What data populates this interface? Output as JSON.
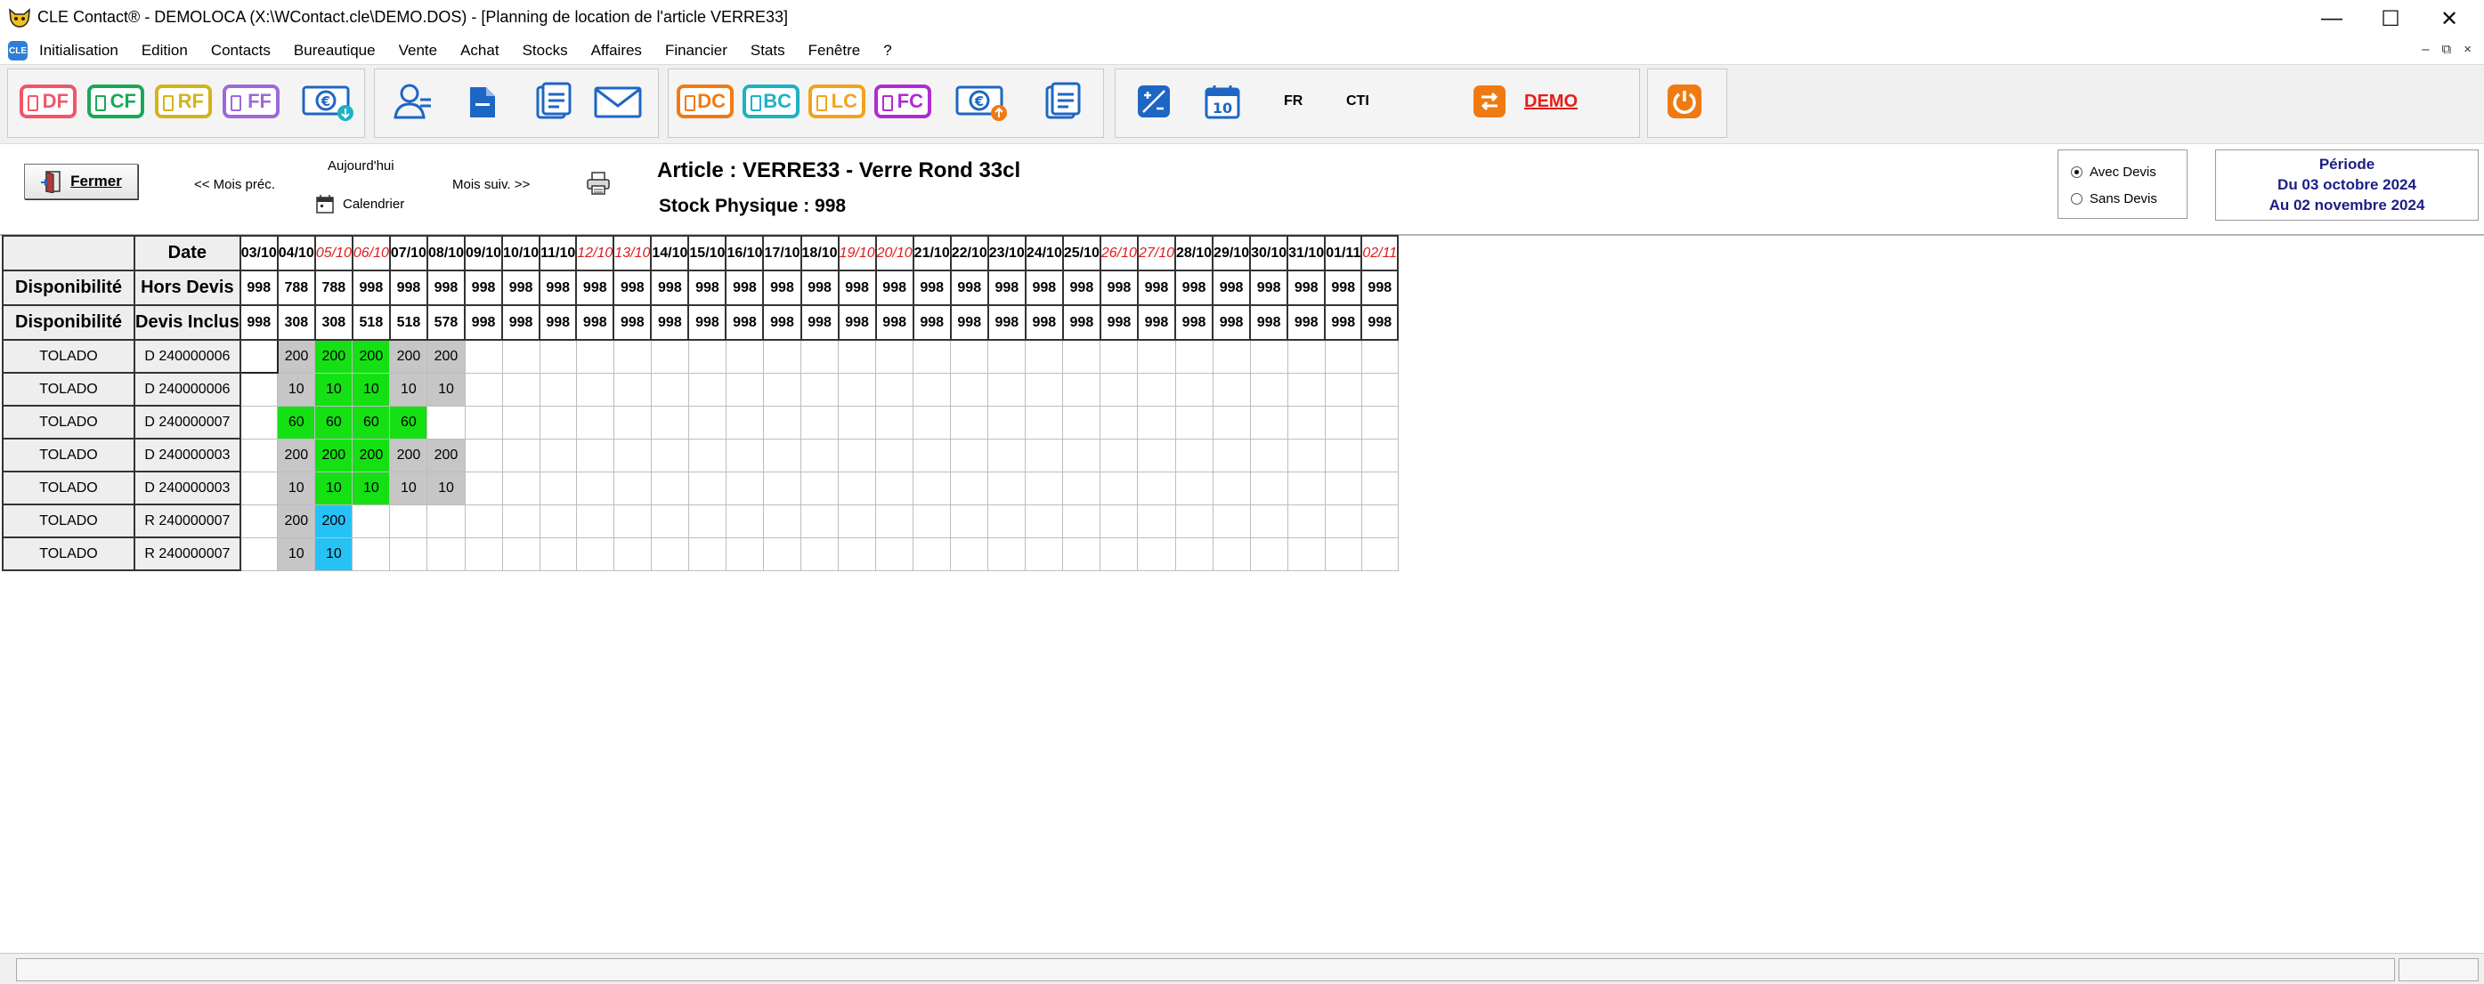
{
  "window": {
    "title": "CLE Contact® - DEMOLOCA (X:\\WContact.cle\\DEMO.DOS) - [Planning de location de l'article VERRE33]",
    "minimize": "—",
    "maximize": "☐",
    "close": "✕"
  },
  "menu": {
    "items": [
      "Initialisation",
      "Edition",
      "Contacts",
      "Bureautique",
      "Vente",
      "Achat",
      "Stocks",
      "Affaires",
      "Financier",
      "Stats",
      "Fenêtre",
      "?"
    ],
    "mdi": [
      "–",
      "⧉",
      "×"
    ]
  },
  "toolbar": {
    "badges": [
      {
        "label": "DF",
        "color": "#f0566a"
      },
      {
        "label": "CF",
        "color": "#19a85a"
      },
      {
        "label": "RF",
        "color": "#d4b21a"
      },
      {
        "label": "FF",
        "color": "#9b6ad8"
      },
      {
        "label": "DC",
        "color": "#f07a12"
      },
      {
        "label": "BC",
        "color": "#1fb1c4"
      },
      {
        "label": "LC",
        "color": "#f2a21c"
      },
      {
        "label": "FC",
        "color": "#b12bd1"
      }
    ],
    "calendar_day": "10",
    "lang": "FR",
    "cti": "CTI",
    "demo": "DEMO",
    "accent": "#1e66c4",
    "demo_color": "#e0201b",
    "orange": "#f07a12"
  },
  "controls": {
    "close_label": "Fermer",
    "prev_month": "<< Mois préc.",
    "today": "Aujourd'hui",
    "calendar": "Calendrier",
    "next_month": "Mois suiv. >>",
    "article": "Article : VERRE33 - Verre Rond 33cl",
    "stock": "Stock Physique : 998",
    "radio_with": "Avec Devis",
    "radio_without": "Sans Devis",
    "radio_selected": "Avec Devis",
    "period_title": "Période",
    "period_from": "Du 03 octobre 2024",
    "period_to": "Au 02 novembre 2024"
  },
  "grid": {
    "col1_header": "",
    "col2_header": "Date",
    "dates": [
      "03/10",
      "04/10",
      "05/10",
      "06/10",
      "07/10",
      "08/10",
      "09/10",
      "10/10",
      "11/10",
      "12/10",
      "13/10",
      "14/10",
      "15/10",
      "16/10",
      "17/10",
      "18/10",
      "19/10",
      "20/10",
      "21/10",
      "22/10",
      "23/10",
      "24/10",
      "25/10",
      "26/10",
      "27/10",
      "28/10",
      "29/10",
      "30/10",
      "31/10",
      "01/11",
      "02/11"
    ],
    "weekend_dates": [
      "05/10",
      "06/10",
      "12/10",
      "13/10",
      "19/10",
      "20/10",
      "26/10",
      "27/10",
      "02/11"
    ],
    "availability": [
      {
        "label": "Disponibilité",
        "type": "Hors Devis",
        "values": [
          "998",
          "788",
          "788",
          "998",
          "998",
          "998",
          "998",
          "998",
          "998",
          "998",
          "998",
          "998",
          "998",
          "998",
          "998",
          "998",
          "998",
          "998",
          "998",
          "998",
          "998",
          "998",
          "998",
          "998",
          "998",
          "998",
          "998",
          "998",
          "998",
          "998",
          "998"
        ]
      },
      {
        "label": "Disponibilité",
        "type": "Devis Inclus",
        "values": [
          "998",
          "308",
          "308",
          "518",
          "518",
          "578",
          "998",
          "998",
          "998",
          "998",
          "998",
          "998",
          "998",
          "998",
          "998",
          "998",
          "998",
          "998",
          "998",
          "998",
          "998",
          "998",
          "998",
          "998",
          "998",
          "998",
          "998",
          "998",
          "998",
          "998",
          "998"
        ]
      }
    ],
    "rows": [
      {
        "client": "TOLADO",
        "doc": "D 240000006",
        "cells": [
          {
            "v": "",
            "c": "sel"
          },
          {
            "v": "200",
            "c": "grey"
          },
          {
            "v": "200",
            "c": "green"
          },
          {
            "v": "200",
            "c": "green"
          },
          {
            "v": "200",
            "c": "grey"
          },
          {
            "v": "200",
            "c": "grey"
          }
        ]
      },
      {
        "client": "TOLADO",
        "doc": "D 240000006",
        "cells": [
          {
            "v": "",
            "c": "empty"
          },
          {
            "v": "10",
            "c": "grey"
          },
          {
            "v": "10",
            "c": "green"
          },
          {
            "v": "10",
            "c": "green"
          },
          {
            "v": "10",
            "c": "grey"
          },
          {
            "v": "10",
            "c": "grey"
          }
        ]
      },
      {
        "client": "TOLADO",
        "doc": "D 240000007",
        "cells": [
          {
            "v": "",
            "c": "empty"
          },
          {
            "v": "60",
            "c": "green"
          },
          {
            "v": "60",
            "c": "green"
          },
          {
            "v": "60",
            "c": "green"
          },
          {
            "v": "60",
            "c": "green"
          }
        ]
      },
      {
        "client": "TOLADO",
        "doc": "D 240000003",
        "cells": [
          {
            "v": "",
            "c": "empty"
          },
          {
            "v": "200",
            "c": "grey"
          },
          {
            "v": "200",
            "c": "green"
          },
          {
            "v": "200",
            "c": "green"
          },
          {
            "v": "200",
            "c": "grey"
          },
          {
            "v": "200",
            "c": "grey"
          }
        ]
      },
      {
        "client": "TOLADO",
        "doc": "D 240000003",
        "cells": [
          {
            "v": "",
            "c": "empty"
          },
          {
            "v": "10",
            "c": "grey"
          },
          {
            "v": "10",
            "c": "green"
          },
          {
            "v": "10",
            "c": "green"
          },
          {
            "v": "10",
            "c": "grey"
          },
          {
            "v": "10",
            "c": "grey"
          }
        ]
      },
      {
        "client": "TOLADO",
        "doc": "R 240000007",
        "cells": [
          {
            "v": "",
            "c": "empty"
          },
          {
            "v": "200",
            "c": "grey"
          },
          {
            "v": "200",
            "c": "blue"
          }
        ]
      },
      {
        "client": "TOLADO",
        "doc": "R 240000007",
        "cells": [
          {
            "v": "",
            "c": "empty"
          },
          {
            "v": "10",
            "c": "grey"
          },
          {
            "v": "10",
            "c": "blue"
          }
        ]
      }
    ],
    "colors": {
      "grey": "#c6c6c6",
      "green": "#14e014",
      "blue": "#27c2f5",
      "weekend": "#e01b1b"
    }
  }
}
